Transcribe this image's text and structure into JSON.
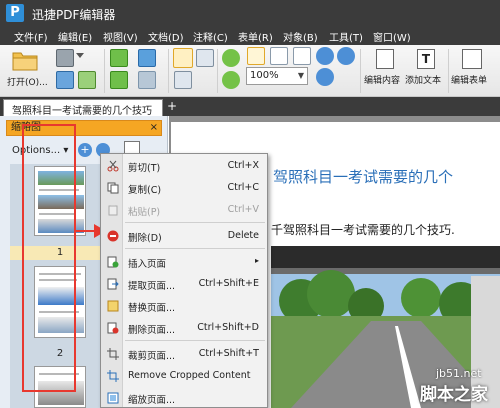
{
  "app": {
    "logo_text": "P",
    "title": "迅捷PDF编辑器"
  },
  "menu": [
    "文件(F)",
    "编辑(E)",
    "视图(V)",
    "文档(D)",
    "注释(C)",
    "表单(R)",
    "对象(B)",
    "工具(T)",
    "窗口(W)"
  ],
  "toolbar": {
    "open_label": "打开(O)...",
    "zoom_value": "100%",
    "edit_content_label": "编辑内容",
    "add_text_label": "添加文本",
    "edit_form_label": "编辑表单"
  },
  "tab": {
    "document_title": "驾照科目一考试需要的几个技巧",
    "new_tab_symbol": "+"
  },
  "thumbnail_pane": {
    "title": "缩略图",
    "close_symbol": "×",
    "options_label": "Options...",
    "page_numbers": [
      "1",
      "2"
    ]
  },
  "document": {
    "title": "驾照科目一考试需要的几个",
    "body_text": "千驾照科目一考试需要的几个技巧."
  },
  "context_menu": {
    "items": [
      {
        "label": "剪切(T)",
        "shortcut": "Ctrl+X"
      },
      {
        "label": "复制(C)",
        "shortcut": "Ctrl+C"
      },
      {
        "label": "粘贴(P)",
        "shortcut": "Ctrl+V"
      },
      {
        "label": "删除(D)",
        "shortcut": "Delete"
      },
      {
        "label": "插入页面",
        "shortcut": ""
      },
      {
        "label": "提取页面...",
        "shortcut": "Ctrl+Shift+E"
      },
      {
        "label": "替换页面...",
        "shortcut": ""
      },
      {
        "label": "删除页面...",
        "shortcut": "Ctrl+Shift+D"
      },
      {
        "label": "裁剪页面...",
        "shortcut": "Ctrl+Shift+T"
      },
      {
        "label": "Remove Cropped Content",
        "shortcut": ""
      },
      {
        "label": "缩放页面...",
        "shortcut": ""
      }
    ],
    "submenu_arrow": "▸"
  },
  "watermark": {
    "site": "jb51.net",
    "brand": "脚本之家"
  },
  "colors": {
    "titlebar": "#3b3b3b",
    "pane_header": "#f5a623",
    "doc_title": "#2a6fb8",
    "annotation_red": "#e8382f"
  }
}
